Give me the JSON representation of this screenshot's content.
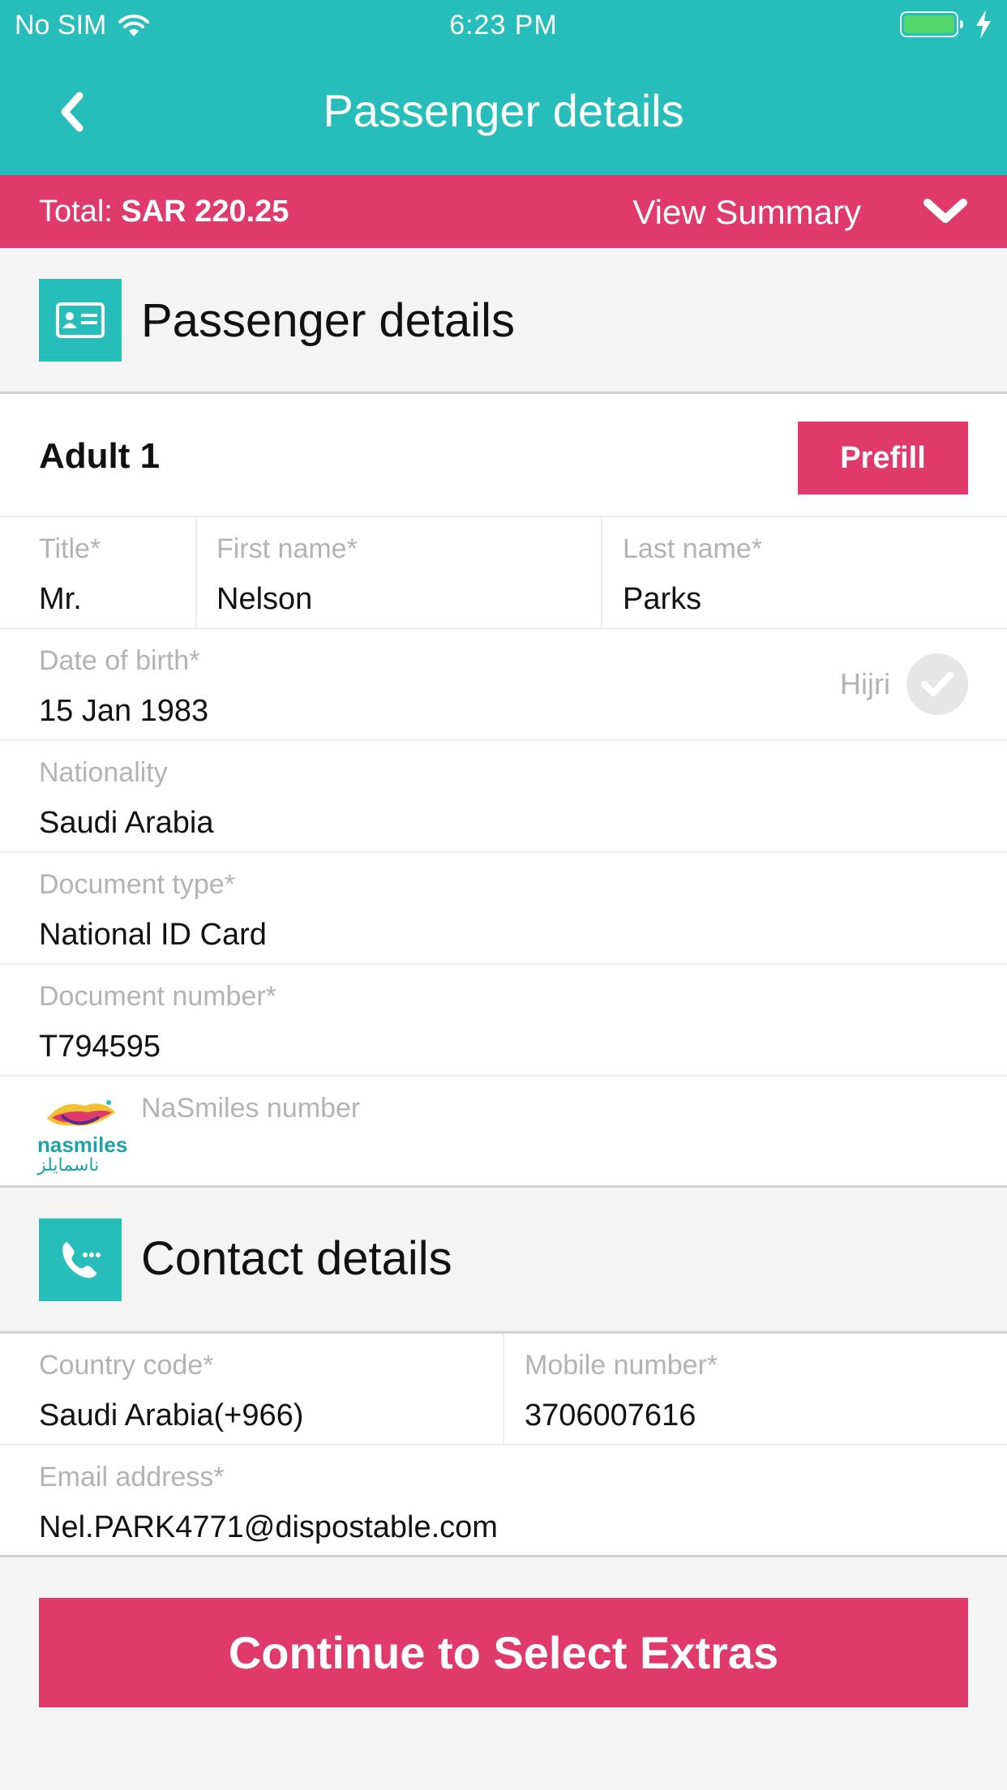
{
  "status_bar": {
    "carrier": "No SIM",
    "time": "6:23 PM"
  },
  "nav": {
    "title": "Passenger details"
  },
  "summary_bar": {
    "total_label": "Total:",
    "total_value": "SAR 220.25",
    "view_summary": "View Summary"
  },
  "passenger_section": {
    "heading": "Passenger details",
    "adult_label": "Adult 1",
    "prefill_label": "Prefill",
    "fields": {
      "title": {
        "label": "Title*",
        "value": "Mr."
      },
      "first_name": {
        "label": "First name*",
        "value": "Nelson"
      },
      "last_name": {
        "label": "Last name*",
        "value": "Parks"
      },
      "dob": {
        "label": "Date of birth*",
        "value": "15 Jan 1983"
      },
      "hijri_label": "Hijri",
      "nationality": {
        "label": "Nationality",
        "value": "Saudi Arabia"
      },
      "doc_type": {
        "label": "Document type*",
        "value": "National ID Card"
      },
      "doc_number": {
        "label": "Document number*",
        "value": "T794595"
      },
      "nasmiles": {
        "label": "NaSmiles number",
        "value": ""
      }
    },
    "nasmiles_logo": {
      "text_en": "nasmiles",
      "text_ar": "ناسمايلز"
    }
  },
  "contact_section": {
    "heading": "Contact details",
    "fields": {
      "country_code": {
        "label": "Country code*",
        "value": "Saudi Arabia(+966)"
      },
      "mobile": {
        "label": "Mobile number*",
        "value": "3706007616"
      },
      "email": {
        "label": "Email address*",
        "value": "Nel.PARK4771@dispostable.com"
      }
    }
  },
  "continue_button": "Continue to Select Extras",
  "colors": {
    "teal": "#26bdbb",
    "pink": "#e03a6c"
  }
}
